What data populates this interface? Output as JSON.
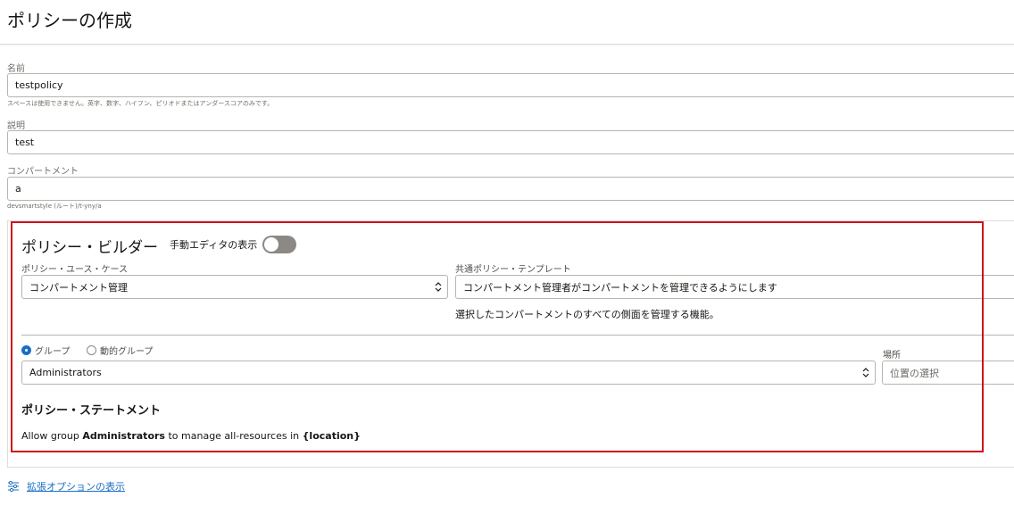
{
  "header": {
    "title": "ポリシーの作成"
  },
  "form": {
    "name": {
      "label": "名前",
      "value": "testpolicy",
      "hint": "スペースは使用できません。英字、数字、ハイフン、ピリオドまたはアンダースコアのみです。"
    },
    "description": {
      "label": "説明",
      "value": "test"
    },
    "compartment": {
      "label": "コンパートメント",
      "value": "a",
      "path": "devsmartstyle (ルート)/t-yny/a"
    }
  },
  "builder": {
    "title": "ポリシー・ビルダー",
    "manual_editor_label": "手動エディタの表示",
    "manual_editor_on": false,
    "use_case": {
      "label": "ポリシー・ユース・ケース",
      "value": "コンパートメント管理"
    },
    "template": {
      "label": "共通ポリシー・テンプレート",
      "value": "コンパートメント管理者がコンパートメントを管理できるようにします",
      "description": "選択したコンパートメントのすべての側面を管理する機能。"
    },
    "radio": {
      "group_label": "グループ",
      "dynamic_group_label": "動的グループ",
      "selected": "group"
    },
    "group_select": {
      "value": "Administrators"
    },
    "location": {
      "label": "場所",
      "placeholder": "位置の選択"
    },
    "statement": {
      "title": "ポリシー・ステートメント",
      "prefix": "Allow group ",
      "group": "Administrators",
      "middle": " to manage all-resources in ",
      "location": "{location}"
    }
  },
  "footer": {
    "advanced_options_label": "拡張オプションの表示",
    "icon": "sliders-icon"
  },
  "colors": {
    "accent": "#1a6fc4",
    "highlight": "#d0101a"
  }
}
